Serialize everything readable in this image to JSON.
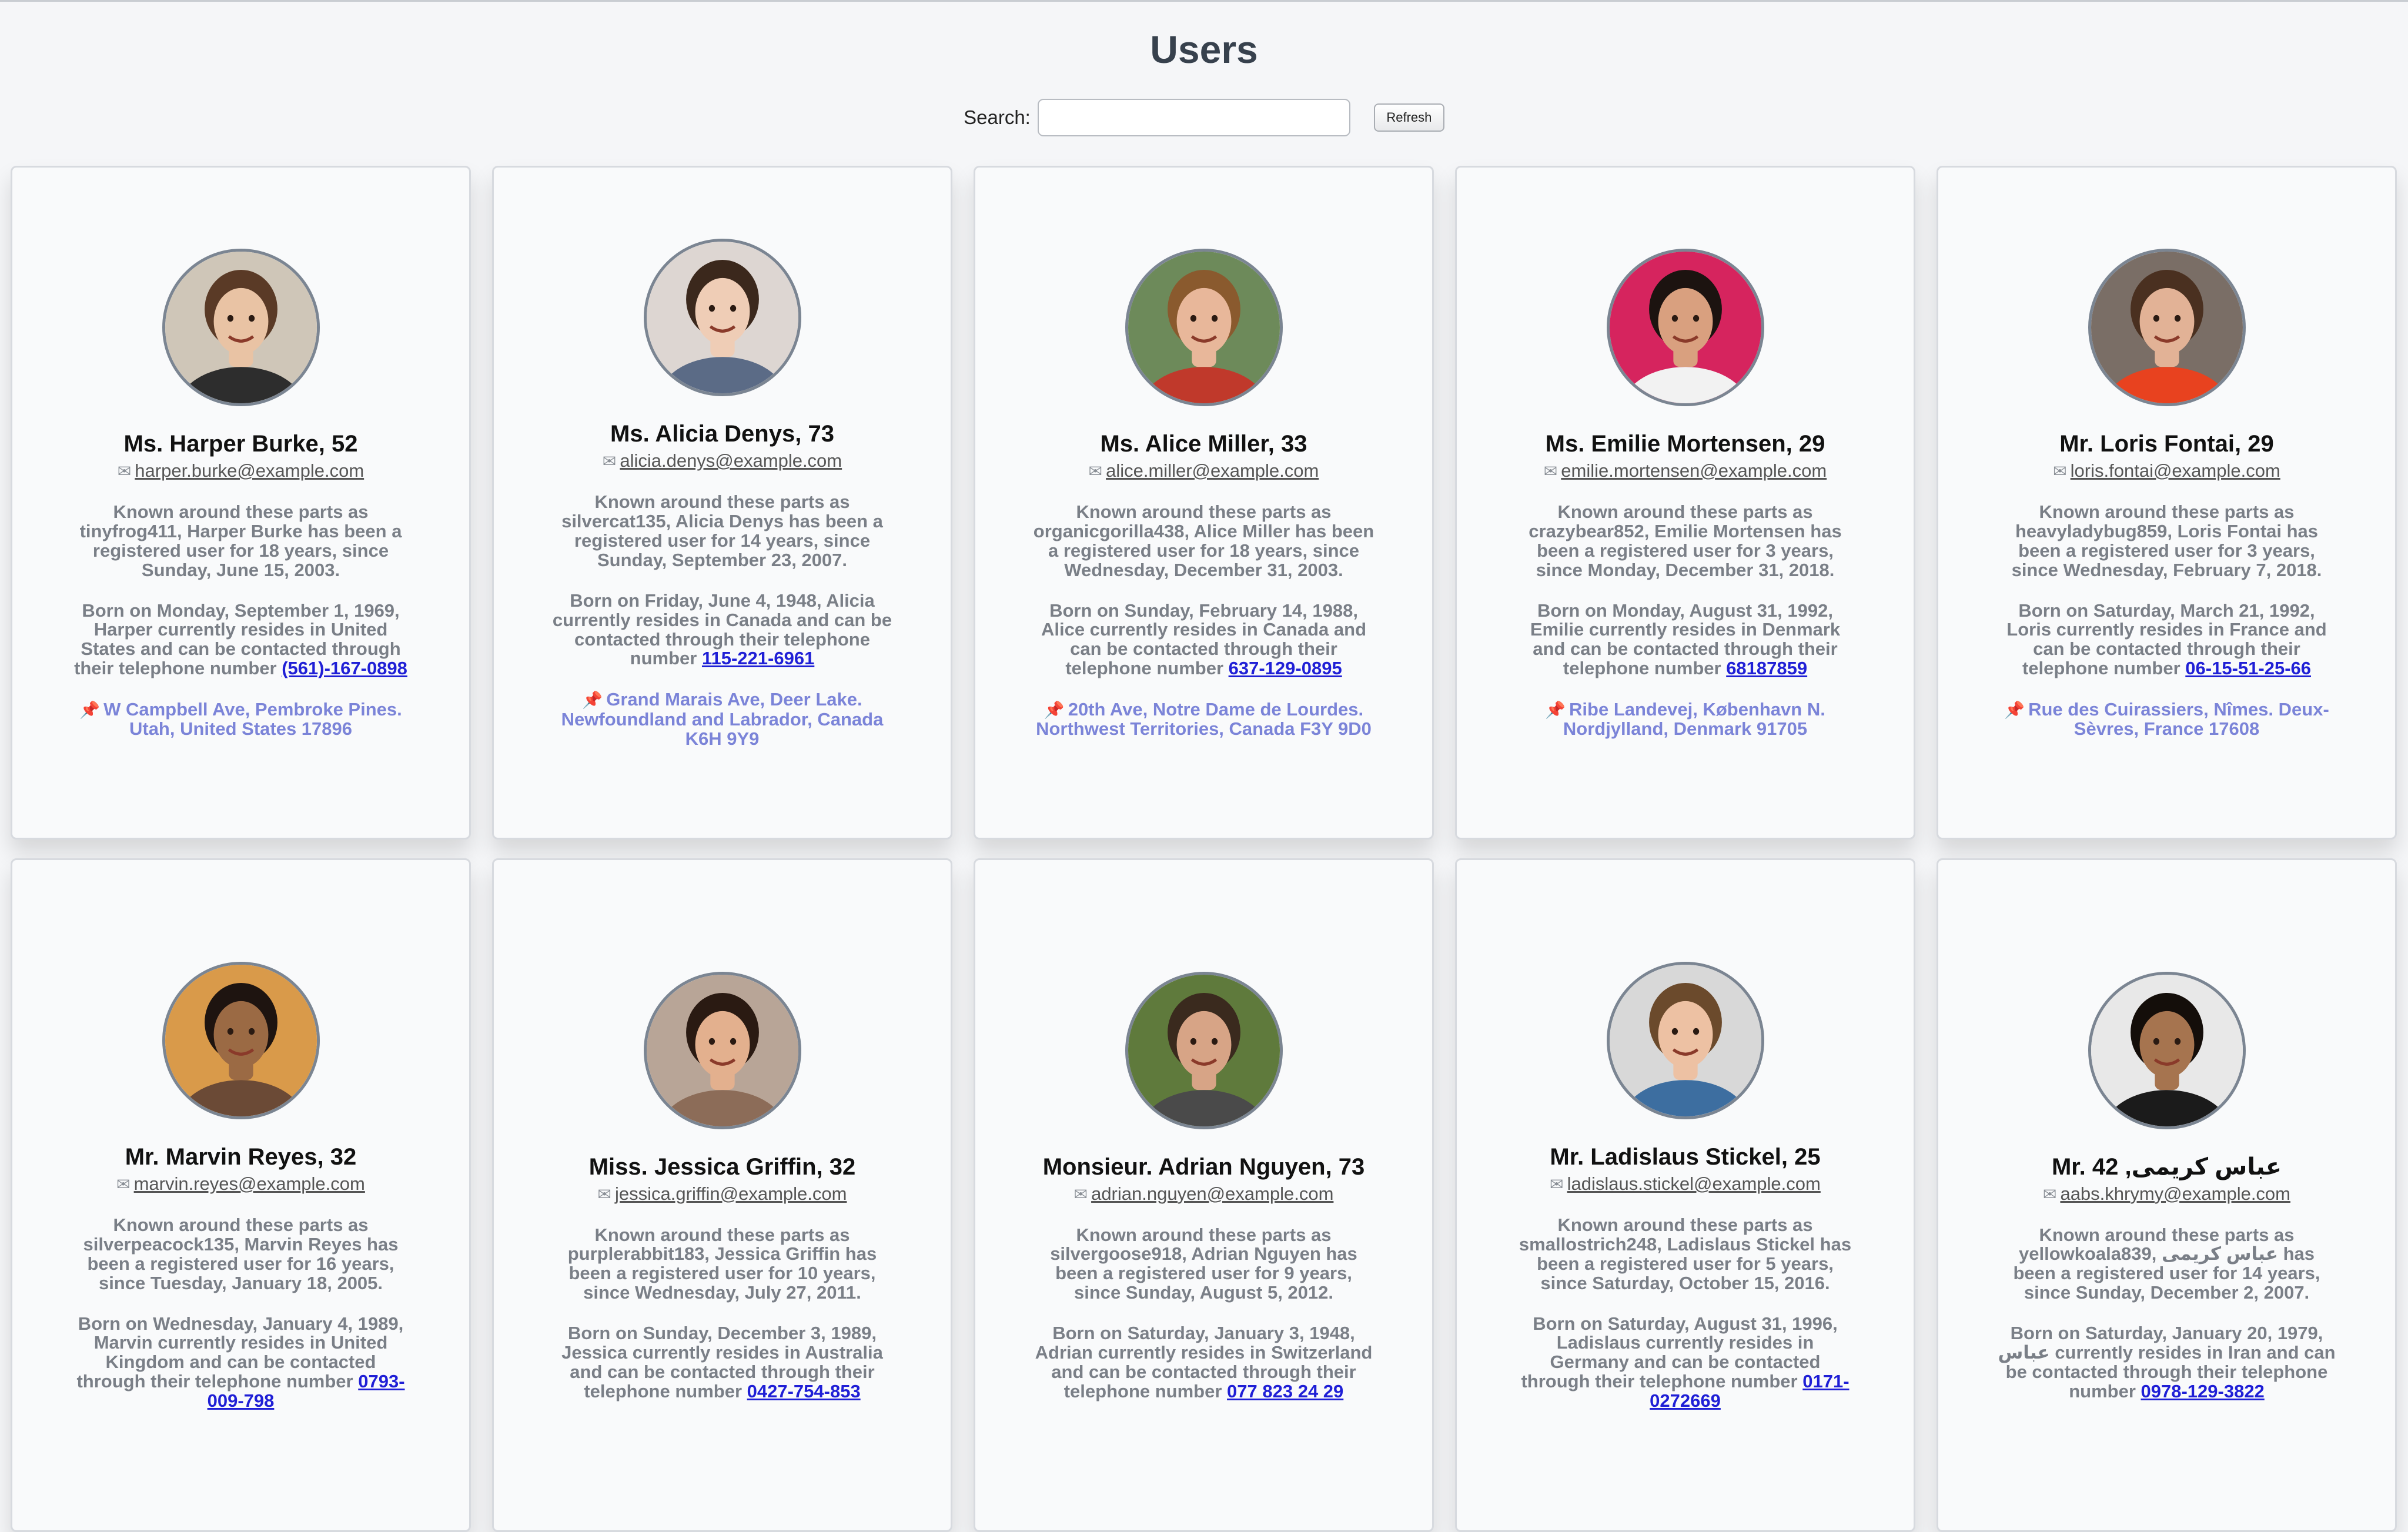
{
  "header": {
    "title": "Users"
  },
  "search": {
    "label": "Search:",
    "placeholder": "",
    "value": "",
    "refresh_label": "Refresh"
  },
  "icons": {
    "mail": "mail-icon",
    "pin": "pushpin-icon"
  },
  "colors": {
    "address": "#7b84d8",
    "phone": "#1f1fd6",
    "title": "#37414d"
  },
  "users": [
    {
      "name": "Ms. Harper Burke, 52",
      "email": "harper.burke@example.com",
      "about": "Known around these parts as tinyfrog411, Harper Burke has been a registered user for 18 years, since Sunday, June 15, 2003.",
      "born": "Born on Monday, September 1, 1969, Harper currently resides in United States and can be contacted through their telephone number ",
      "phone": "(561)-167-0898",
      "address": "W Campbell Ave, Pembroke Pines. Utah, United States 17896",
      "skin": "#e9c3a4",
      "hair": "#5a3a26",
      "bg": "#cfc6b8",
      "shirt": "#2d2d2d"
    },
    {
      "name": "Ms. Alicia Denys, 73",
      "email": "alicia.denys@example.com",
      "about": "Known around these parts as silvercat135, Alicia Denys has been a registered user for 14 years, since Sunday, September 23, 2007.",
      "born": "Born on Friday, June 4, 1948, Alicia currently resides in Canada and can be contacted through their telephone number ",
      "phone": "115-221-6961",
      "address": "Grand Marais Ave, Deer Lake. Newfoundland and Labrador, Canada K6H 9Y9",
      "skin": "#efcdb6",
      "hair": "#3b281c",
      "bg": "#ddd6d2",
      "shirt": "#5b6b86"
    },
    {
      "name": "Ms. Alice Miller, 33",
      "email": "alice.miller@example.com",
      "about": "Known around these parts as organicgorilla438, Alice Miller has been a registered user for 18 years, since Wednesday, December 31, 2003.",
      "born": "Born on Sunday, February 14, 1988, Alice currently resides in Canada and can be contacted through their telephone number ",
      "phone": "637-129-0895",
      "address": "20th Ave, Notre Dame de Lourdes. Northwest Territories, Canada F3Y 9D0",
      "skin": "#e8b79a",
      "hair": "#8a5a2e",
      "bg": "#6d8a5a",
      "shirt": "#c0392b"
    },
    {
      "name": "Ms. Emilie Mortensen, 29",
      "email": "emilie.mortensen@example.com",
      "about": "Known around these parts as crazybear852, Emilie Mortensen has been a registered user for 3 years, since Monday, December 31, 2018.",
      "born": "Born on Monday, August 31, 1992, Emilie currently resides in Denmark and can be contacted through their telephone number ",
      "phone": "68187859",
      "address": "Ribe Landevej, København N. Nordjylland, Denmark 91705",
      "skin": "#d9a07f",
      "hair": "#1c1310",
      "bg": "#d6245e",
      "shirt": "#f2f2f2"
    },
    {
      "name": "Mr. Loris Fontai, 29",
      "email": "loris.fontai@example.com",
      "about": "Known around these parts as heavyladybug859, Loris Fontai has been a registered user for 3 years, since Wednesday, February 7, 2018.",
      "born": "Born on Saturday, March 21, 1992, Loris currently resides in France and can be contacted through their telephone number ",
      "phone": "06-15-51-25-66",
      "address": "Rue des Cuirassiers, Nîmes. Deux-Sèvres, France 17608",
      "skin": "#e2b296",
      "hair": "#4a3020",
      "bg": "#7a6e66",
      "shirt": "#e8421f"
    },
    {
      "name": "Mr. Marvin Reyes, 32",
      "email": "marvin.reyes@example.com",
      "about": "Known around these parts as silverpeacock135, Marvin Reyes has been a registered user for 16 years, since Tuesday, January 18, 2005.",
      "born": "Born on Wednesday, January 4, 1989, Marvin currently resides in United Kingdom and can be contacted through their telephone number ",
      "phone": "0793-009-798",
      "address": "",
      "skin": "#9b6a44",
      "hair": "#1e1410",
      "bg": "#d99a4a",
      "shirt": "#6b4a36"
    },
    {
      "name": "Miss. Jessica Griffin, 32",
      "email": "jessica.griffin@example.com",
      "about": "Known around these parts as purplerabbit183, Jessica Griffin has been a registered user for 10 years, since Wednesday, July 27, 2011.",
      "born": "Born on Sunday, December 3, 1989, Jessica currently resides in Australia and can be contacted through their telephone number ",
      "phone": "0427-754-853",
      "address": "",
      "skin": "#e3b08e",
      "hair": "#2a1a12",
      "bg": "#b8a597",
      "shirt": "#8c6c58"
    },
    {
      "name": "Monsieur. Adrian Nguyen, 73",
      "email": "adrian.nguyen@example.com",
      "about": "Known around these parts as silvergoose918, Adrian Nguyen has been a registered user for 9 years, since Sunday, August 5, 2012.",
      "born": "Born on Saturday, January 3, 1948, Adrian currently resides in Switzerland and can be contacted through their telephone number ",
      "phone": "077 823 24 29",
      "address": "",
      "skin": "#d7a486",
      "hair": "#3a2a1e",
      "bg": "#5f7a3c",
      "shirt": "#4a4a4a"
    },
    {
      "name": "Mr. Ladislaus Stickel, 25",
      "email": "ladislaus.stickel@example.com",
      "about": "Known around these parts as smallostrich248, Ladislaus Stickel has been a registered user for 5 years, since Saturday, October 15, 2016.",
      "born": "Born on Saturday, August 31, 1996, Ladislaus currently resides in Germany and can be contacted through their telephone number ",
      "phone": "0171-0272669",
      "address": "",
      "skin": "#edc1a3",
      "hair": "#6b4a2c",
      "bg": "#d8d8d8",
      "shirt": "#3d6ea0"
    },
    {
      "name": "Mr. 42 ,عباس کریمی",
      "email": "aabs.khrymy@example.com",
      "about": "Known around these parts as yellowkoala839, عباس کریمی has been a registered user for 14 years, since Sunday, December 2, 2007.",
      "born": "Born on Saturday, January 20, 1979, عباس currently resides in Iran and can be contacted through their telephone number ",
      "phone": "0978-129-3822",
      "address": "",
      "skin": "#a6744f",
      "hair": "#140e0a",
      "bg": "#e8e8e8",
      "shirt": "#1b1b1b"
    }
  ]
}
